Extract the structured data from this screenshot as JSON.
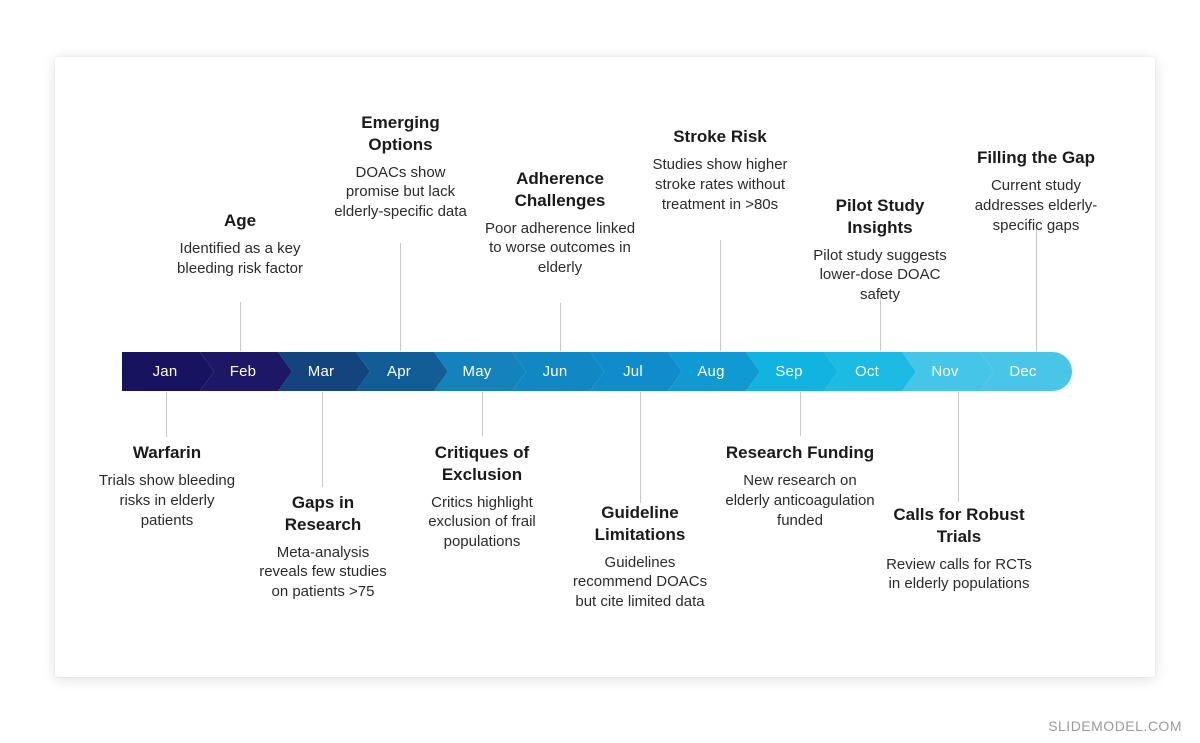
{
  "timeline": {
    "type": "horizontal-chevron-timeline",
    "segments": [
      {
        "label": "Jan",
        "color": "#17135e"
      },
      {
        "label": "Feb",
        "color": "#1c1866"
      },
      {
        "label": "Mar",
        "color": "#14447e"
      },
      {
        "label": "Apr",
        "color": "#125d96"
      },
      {
        "label": "May",
        "color": "#1483bd"
      },
      {
        "label": "Jun",
        "color": "#1187c4"
      },
      {
        "label": "Jul",
        "color": "#0f8ccb"
      },
      {
        "label": "Aug",
        "color": "#109ad4"
      },
      {
        "label": "Sep",
        "color": "#11b4e0"
      },
      {
        "label": "Oct",
        "color": "#1cbbe4"
      },
      {
        "label": "Nov",
        "color": "#45c6e9"
      },
      {
        "label": "Dec",
        "color": "#49c5e8"
      }
    ]
  },
  "milestones_above": [
    {
      "title": "Age",
      "description": "Identified as a key bleeding risk factor",
      "anchor_month": "Feb"
    },
    {
      "title": "Emerging Options",
      "description": "DOACs show promise but lack elderly-specific data",
      "anchor_month": "Apr"
    },
    {
      "title": "Adherence Challenges",
      "description": "Poor adherence linked to worse outcomes in elderly",
      "anchor_month": "Jun"
    },
    {
      "title": "Stroke Risk",
      "description": "Studies show higher stroke rates without treatment in >80s",
      "anchor_month": "Aug"
    },
    {
      "title": "Pilot Study Insights",
      "description": "Pilot study suggests lower-dose DOAC safety",
      "anchor_month": "Oct"
    },
    {
      "title": "Filling the Gap",
      "description": "Current study addresses elderly-specific gaps",
      "anchor_month": "Dec"
    }
  ],
  "milestones_below": [
    {
      "title": "Warfarin",
      "description": "Trials show bleeding risks in elderly patients",
      "anchor_month": "Jan"
    },
    {
      "title": "Gaps in Research",
      "description": "Meta-analysis reveals few studies on patients >75",
      "anchor_month": "Mar"
    },
    {
      "title": "Critiques of Exclusion",
      "description": "Critics highlight exclusion of frail populations",
      "anchor_month": "May"
    },
    {
      "title": "Guideline Limitations",
      "description": "Guidelines recommend DOACs but cite limited data",
      "anchor_month": "Jul"
    },
    {
      "title": "Research Funding",
      "description": "New research on elderly anticoagulation funded",
      "anchor_month": "Sep"
    },
    {
      "title": "Calls for Robust Trials",
      "description": "Review calls for RCTs in elderly populations",
      "anchor_month": "Nov"
    }
  ],
  "footer": {
    "watermark": "SLIDEMODEL.COM"
  }
}
